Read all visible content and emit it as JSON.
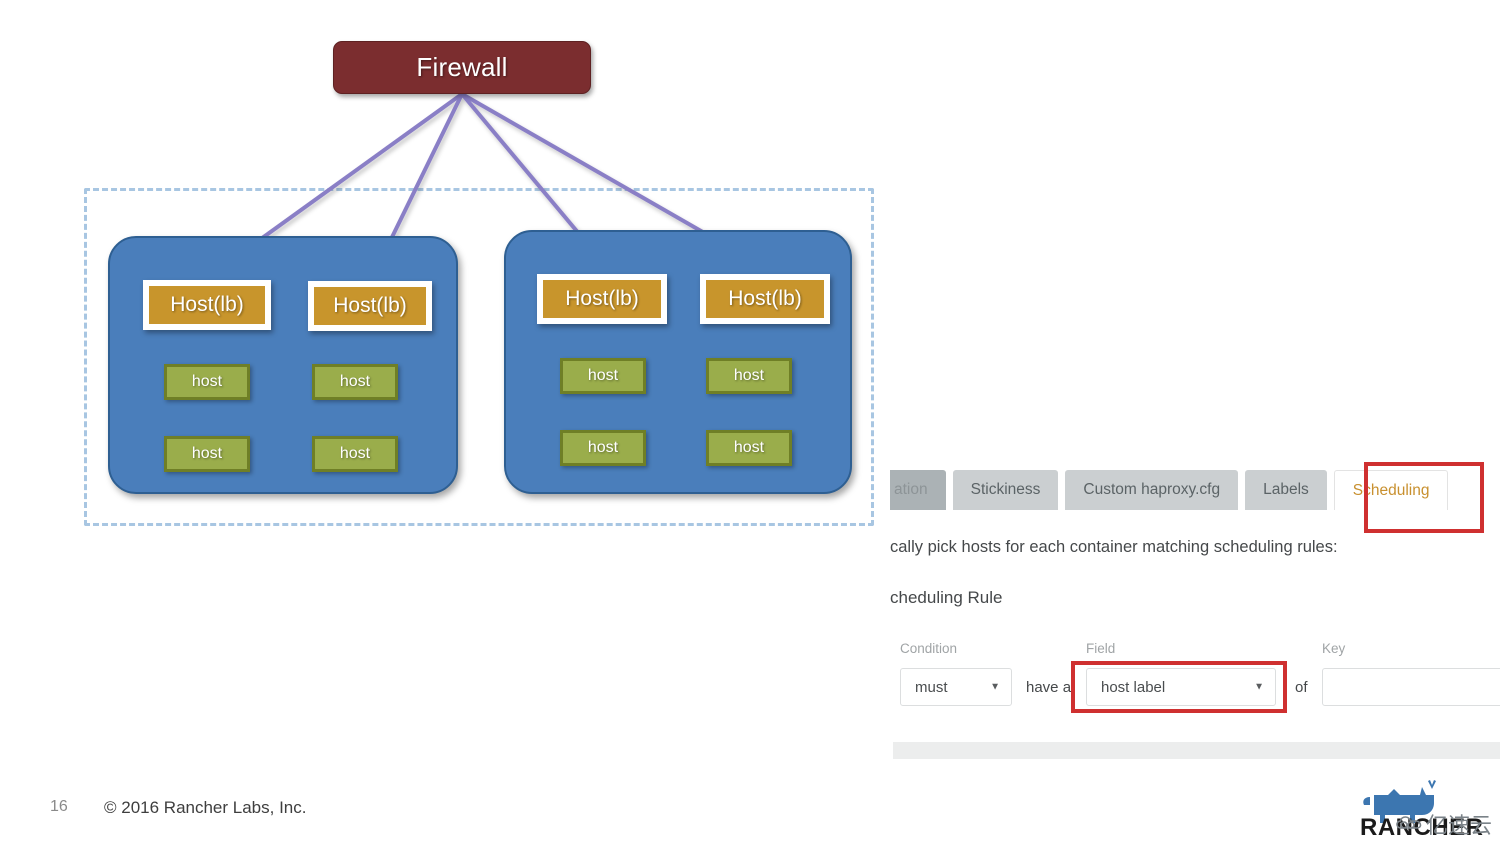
{
  "slide": {
    "firewall": {
      "label": "Firewall"
    },
    "groups": [
      {
        "name": "left-group",
        "lb_hosts": [
          {
            "label": "Host(lb)"
          },
          {
            "label": "Host(lb)"
          }
        ],
        "hosts": [
          {
            "label": "host"
          },
          {
            "label": "host"
          },
          {
            "label": "host"
          },
          {
            "label": "host"
          }
        ]
      },
      {
        "name": "right-group",
        "lb_hosts": [
          {
            "label": "Host(lb)"
          },
          {
            "label": "Host(lb)"
          }
        ],
        "hosts": [
          {
            "label": "host"
          },
          {
            "label": "host"
          },
          {
            "label": "host"
          },
          {
            "label": "host"
          }
        ]
      }
    ],
    "footer": {
      "slide_number": "16",
      "copyright": "© 2016 Rancher Labs, Inc."
    },
    "colors": {
      "firewall": "#7b2d2f",
      "group_box": "#4a7ebb",
      "lb_host": "#c8952c",
      "host": "#9aad4b",
      "dashed_border": "#a8c6e2",
      "arrow": "#8a7fc6"
    }
  },
  "ui_panel": {
    "tabs": [
      {
        "label": "ation",
        "state": "cut-off"
      },
      {
        "label": "Stickiness",
        "state": "inactive"
      },
      {
        "label": "Custom haproxy.cfg",
        "state": "inactive"
      },
      {
        "label": "Labels",
        "state": "inactive"
      },
      {
        "label": "Scheduling",
        "state": "active"
      }
    ],
    "intro_text": "cally pick hosts for each container matching scheduling rules:",
    "rule_heading": "cheduling Rule",
    "rule": {
      "condition_label": "Condition",
      "condition_value": "must",
      "connector_text": "have a",
      "field_label": "Field",
      "field_value": "host label",
      "of_text": "of",
      "key_label": "Key",
      "key_value": "",
      "key_placeholder": ""
    },
    "highlight_color": "#cf3030",
    "active_tab_text_color": "#c8902f"
  },
  "branding": {
    "wordmark": "RANCHER",
    "watermark_text": "亿速云",
    "logo_color": "#3c76b0"
  }
}
